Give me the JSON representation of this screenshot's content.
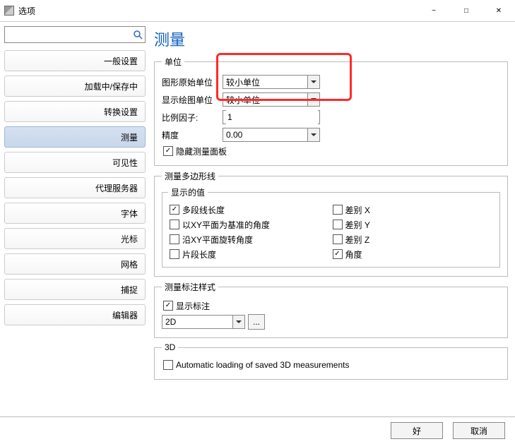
{
  "window": {
    "title": "选项"
  },
  "sidebar": {
    "search_placeholder": "",
    "items": [
      {
        "label": "一般设置",
        "selected": false
      },
      {
        "label": "加载中/保存中",
        "selected": false
      },
      {
        "label": "转换设置",
        "selected": false
      },
      {
        "label": "测量",
        "selected": true
      },
      {
        "label": "可见性",
        "selected": false
      },
      {
        "label": "代理服务器",
        "selected": false
      },
      {
        "label": "字体",
        "selected": false
      },
      {
        "label": "光标",
        "selected": false
      },
      {
        "label": "网格",
        "selected": false
      },
      {
        "label": "捕捉",
        "selected": false
      },
      {
        "label": "编辑器",
        "selected": false
      }
    ]
  },
  "page": {
    "title": "测量",
    "group_units": {
      "legend": "单位",
      "drawing_original_label": "图形原始单位",
      "drawing_original_value": "较小单位",
      "display_drawing_label": "显示绘图单位",
      "display_drawing_value": "较小单位",
      "scale_factor_label": "比例因子:",
      "scale_factor_value": "1",
      "precision_label": "精度",
      "precision_value": "0.00",
      "hide_panel_label": "隐藏测量面板",
      "hide_panel_checked": true
    },
    "group_polyline": {
      "legend": "测量多边形线",
      "inner_legend": "显示的值",
      "left": [
        {
          "label": "多段线长度",
          "checked": true
        },
        {
          "label": "以XY平面为基准的角度",
          "checked": false
        },
        {
          "label": "沿XY平面旋转角度",
          "checked": false
        },
        {
          "label": "片段长度",
          "checked": false
        }
      ],
      "right": [
        {
          "label": "差别 X",
          "checked": false
        },
        {
          "label": "差别 Y",
          "checked": false
        },
        {
          "label": "差别 Z",
          "checked": false
        },
        {
          "label": "角度",
          "checked": true
        }
      ]
    },
    "group_style": {
      "legend": "测量标注样式",
      "show_annotation_label": "显示标注",
      "show_annotation_checked": true,
      "mode_value": "2D",
      "more_btn": "..."
    },
    "group_3d": {
      "legend": "3D",
      "auto_load_label": "Automatic loading of saved 3D measurements",
      "auto_load_checked": false
    }
  },
  "footer": {
    "ok": "好",
    "cancel": "取消"
  }
}
